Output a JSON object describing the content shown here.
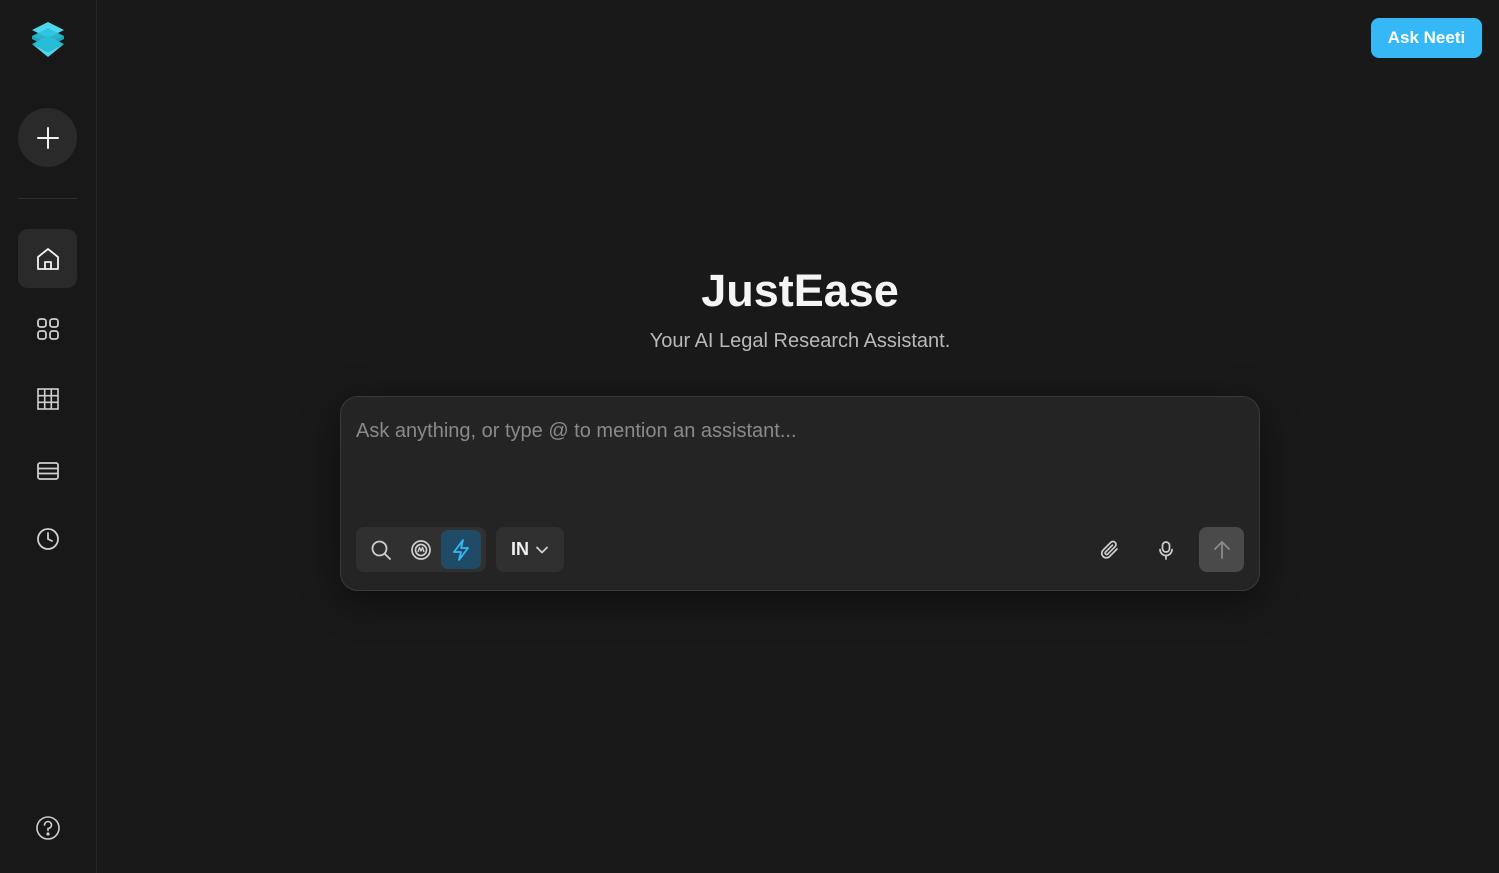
{
  "sidebar": {
    "logo_icon": "layers-logo-icon",
    "new_chat_icon": "plus-icon",
    "items": [
      {
        "icon": "home-icon",
        "active": true
      },
      {
        "icon": "apps-icon",
        "active": false
      },
      {
        "icon": "grid-icon",
        "active": false
      },
      {
        "icon": "table-icon",
        "active": false
      },
      {
        "icon": "history-icon",
        "active": false
      }
    ],
    "help_icon": "help-circle-icon"
  },
  "header": {
    "ask_button_label": "Ask Neeti"
  },
  "hero": {
    "title": "JustEase",
    "subtitle": "Your AI Legal Research Assistant."
  },
  "composer": {
    "placeholder": "Ask anything, or type @ to mention an assistant...",
    "value": "",
    "modes": [
      {
        "icon": "search-icon",
        "selected": false
      },
      {
        "icon": "deep-research-icon",
        "selected": false
      },
      {
        "icon": "lightning-icon",
        "selected": true
      }
    ],
    "region": "IN",
    "attach_icon": "paperclip-icon",
    "mic_icon": "microphone-icon",
    "send_icon": "arrow-up-icon"
  },
  "colors": {
    "background": "#191919",
    "sidebar": "#181818",
    "accent": "#35b8f5",
    "logo_light": "#4fd8ec",
    "logo_dark": "#1aa9c2",
    "active_mode": "#1f4b66"
  }
}
